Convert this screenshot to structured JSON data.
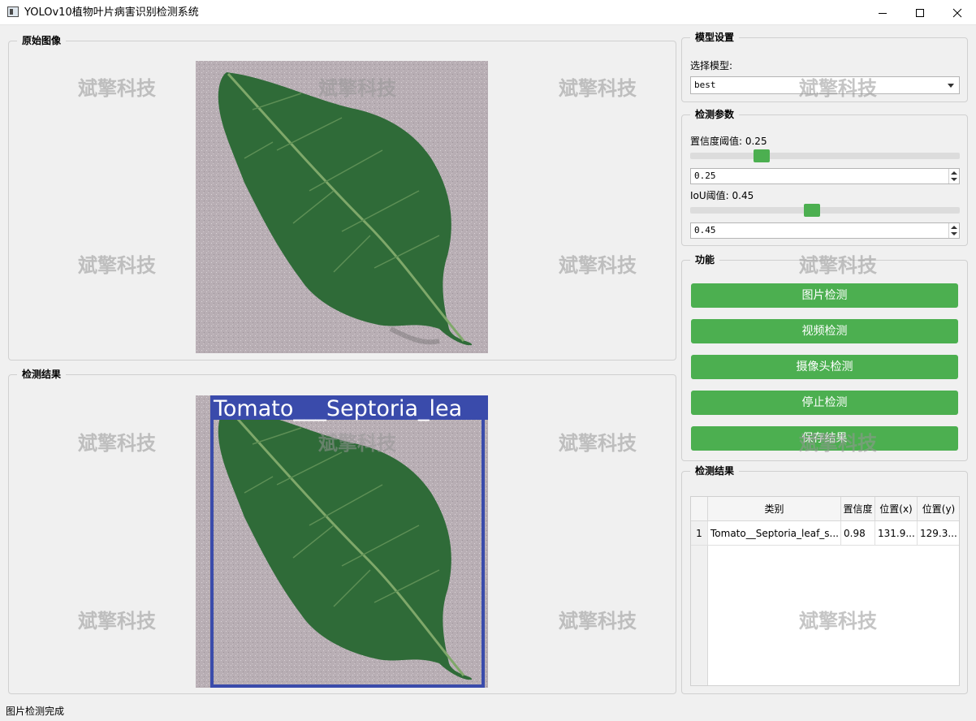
{
  "window": {
    "title": "YOLOv10植物叶片病害识别检测系统",
    "controls": [
      "minimize-icon",
      "maximize-icon",
      "close-icon"
    ]
  },
  "watermark": "斌擎科技",
  "original_image": {
    "group_title": "原始图像"
  },
  "result_image": {
    "group_title": "检测结果",
    "box_label": "Tomato___Septoria_lea",
    "box_color": "#3a4bab"
  },
  "model_settings": {
    "group_title": "模型设置",
    "select_label": "选择模型:",
    "selected_model": "best"
  },
  "params": {
    "group_title": "检测参数",
    "confidence_label": "置信度阈值: 0.25",
    "confidence_value": "0.25",
    "iou_label": "IoU阈值: 0.45",
    "iou_value": "0.45"
  },
  "functions": {
    "group_title": "功能",
    "buttons": [
      "图片检测",
      "视频检测",
      "摄像头检测",
      "停止检测",
      "保存结果"
    ],
    "accent": "#4caf50"
  },
  "results": {
    "group_title": "检测结果",
    "columns": [
      "类别",
      "置信度",
      "位置(x)",
      "位置(y)"
    ],
    "rows": [
      {
        "index": "1",
        "cells": [
          "Tomato__Septoria_leaf_s...",
          "0.98",
          "131.9...",
          "129.3..."
        ]
      }
    ]
  },
  "status": "图片检测完成"
}
